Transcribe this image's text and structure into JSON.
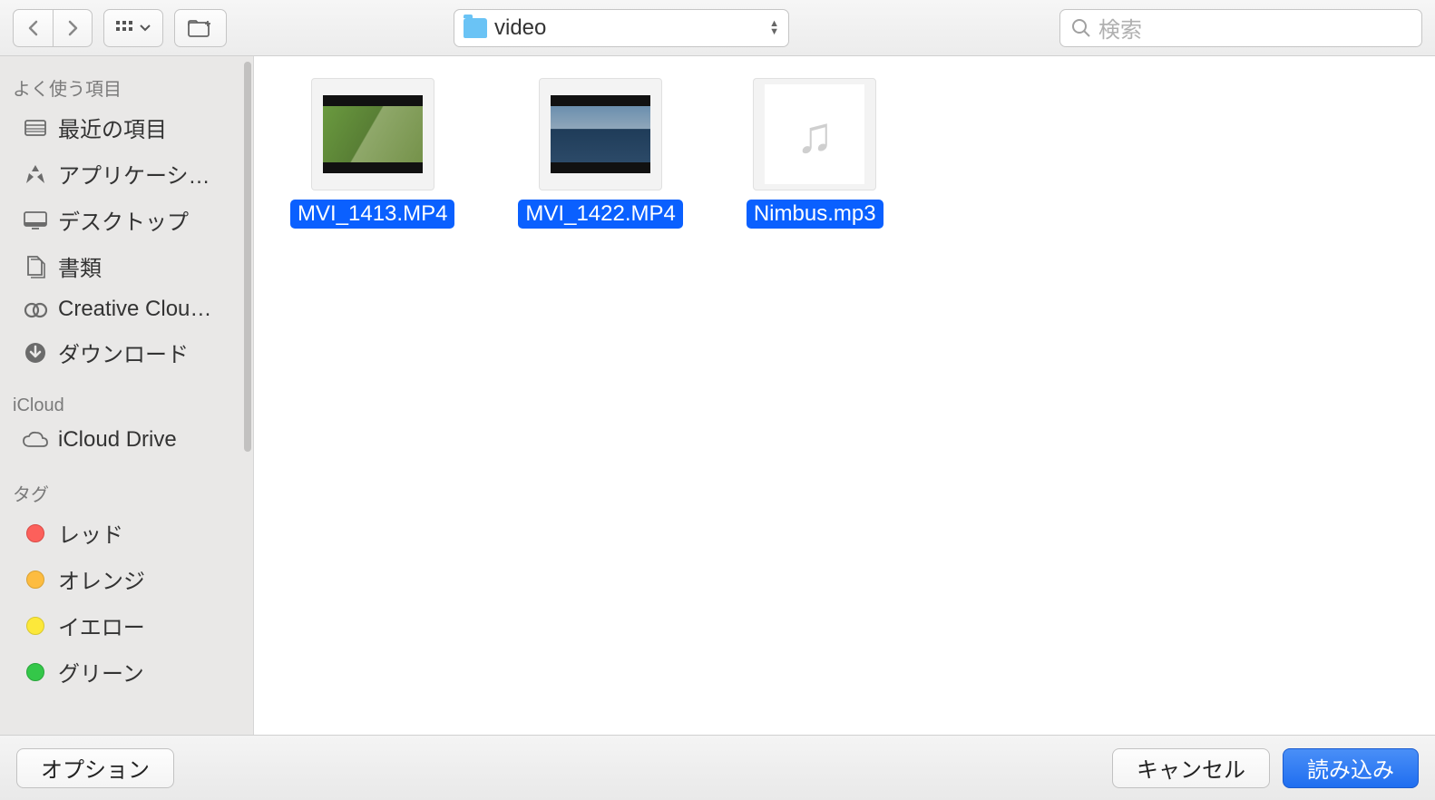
{
  "toolbar": {
    "current_folder": "video",
    "search_placeholder": "検索"
  },
  "sidebar": {
    "favorites_header": "よく使う項目",
    "favorites": [
      {
        "label": "最近の項目",
        "icon": "recent"
      },
      {
        "label": "アプリケーシ…",
        "icon": "apps"
      },
      {
        "label": "デスクトップ",
        "icon": "desktop"
      },
      {
        "label": "書類",
        "icon": "documents"
      },
      {
        "label": "Creative Clou…",
        "icon": "cc"
      },
      {
        "label": "ダウンロード",
        "icon": "downloads"
      }
    ],
    "icloud_header": "iCloud",
    "icloud": [
      {
        "label": "iCloud Drive",
        "icon": "cloud"
      }
    ],
    "tags_header": "タグ",
    "tags": [
      {
        "label": "レッド",
        "color": "red"
      },
      {
        "label": "オレンジ",
        "color": "orange"
      },
      {
        "label": "イエロー",
        "color": "yellow"
      },
      {
        "label": "グリーン",
        "color": "green"
      }
    ]
  },
  "files": [
    {
      "name": "MVI_1413.MP4",
      "type": "video1"
    },
    {
      "name": "MVI_1422.MP4",
      "type": "video2"
    },
    {
      "name": "Nimbus.mp3",
      "type": "audio"
    }
  ],
  "footer": {
    "options": "オプション",
    "cancel": "キャンセル",
    "import": "読み込み"
  }
}
